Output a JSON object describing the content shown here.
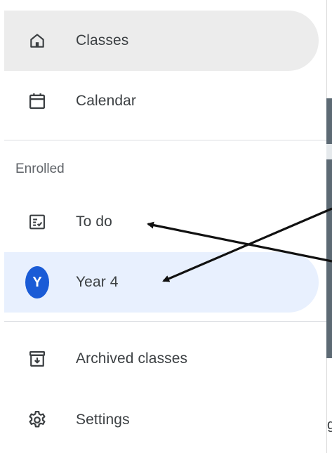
{
  "sidebar": {
    "items": [
      {
        "label": "Classes",
        "icon": "home-icon"
      },
      {
        "label": "Calendar",
        "icon": "calendar-icon"
      }
    ],
    "section_header": "Enrolled",
    "enrolled": [
      {
        "label": "To do",
        "icon": "todo-list-icon"
      },
      {
        "label": "Year 4",
        "avatar_letter": "Y",
        "avatar_color": "#1a5bd6"
      }
    ],
    "footer_items": [
      {
        "label": "Archived classes",
        "icon": "archive-icon"
      },
      {
        "label": "Settings",
        "icon": "gear-icon"
      }
    ]
  },
  "edge_fragment": "g",
  "colors": {
    "selected_bg": "#e8f0fe",
    "hover_bg": "#ececec",
    "text": "#3c4043",
    "muted": "#5f6368",
    "accent": "#1a5bd6"
  }
}
